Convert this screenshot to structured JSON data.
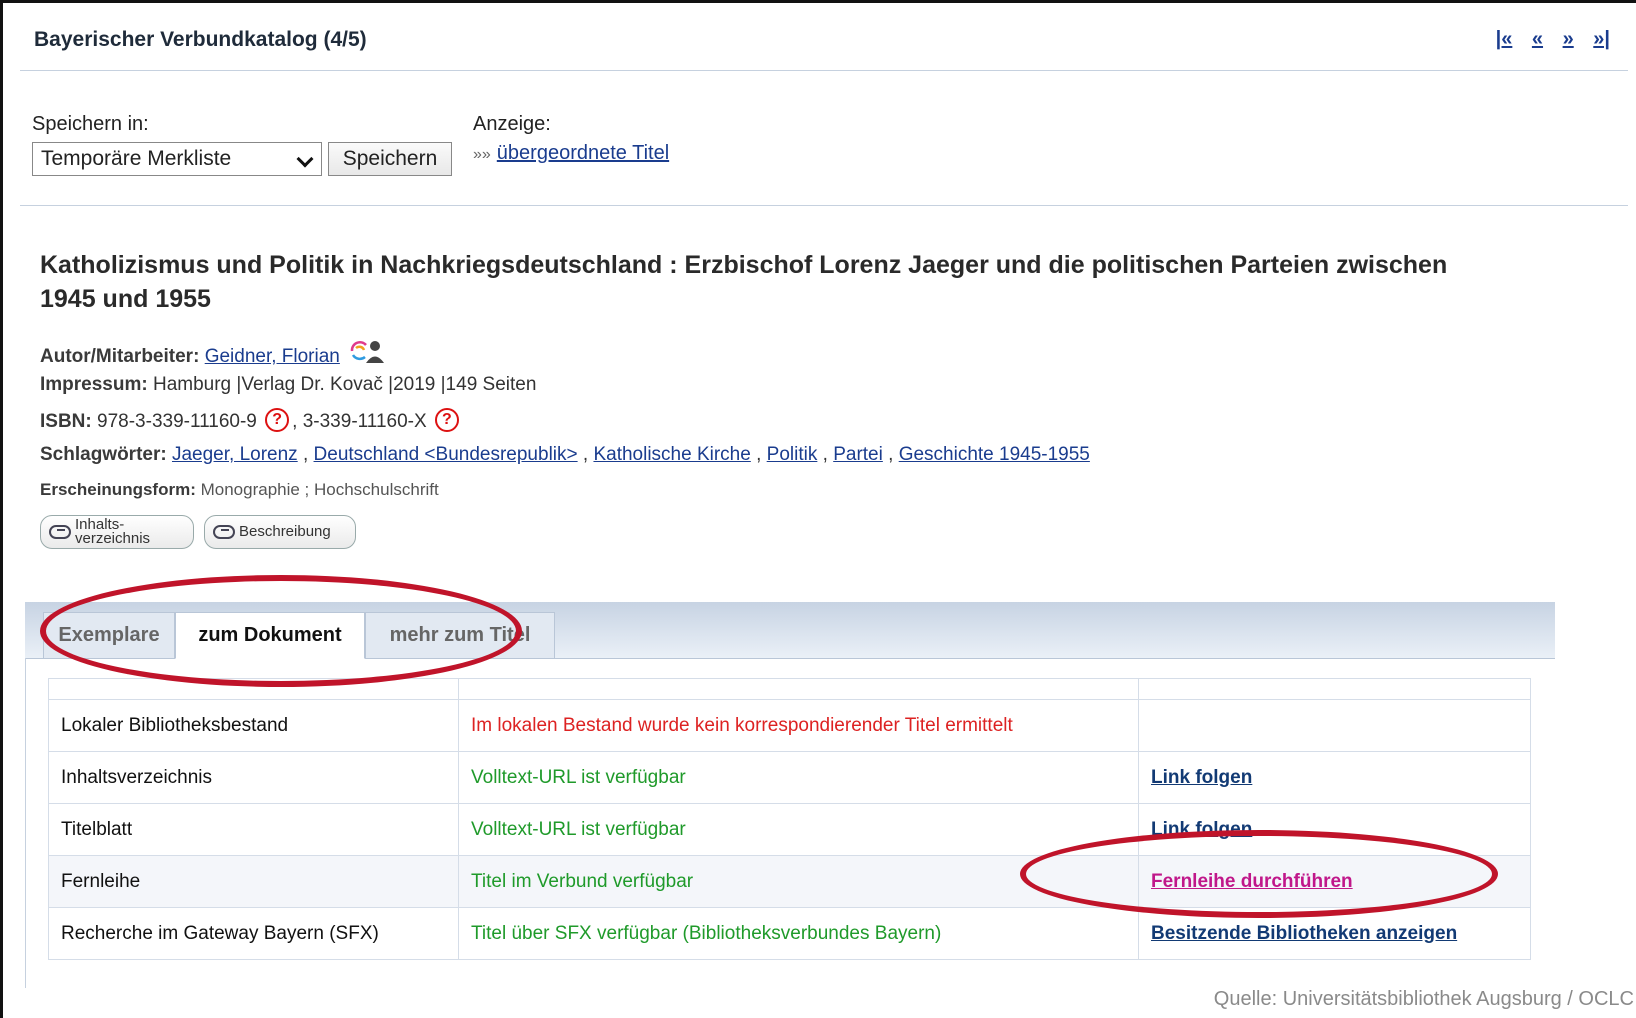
{
  "header": {
    "title": "Bayerischer Verbundkatalog (4/5)",
    "nav": [
      "|«",
      "«",
      "»",
      "»|"
    ]
  },
  "save": {
    "label": "Speichern in:",
    "selected": "Temporäre Merkliste",
    "button": "Speichern"
  },
  "display": {
    "label": "Anzeige:",
    "prefix": "»»",
    "link": "übergeordnete Titel"
  },
  "record": {
    "title": "Katholizismus und Politik in Nachkriegsdeutschland : Erzbischof Lorenz Jaeger und die politischen Parteien zwischen 1945 und 1955",
    "author_label": "Autor/Mitarbeiter:",
    "author": "Geidner, Florian",
    "impressum_label": "Impressum:",
    "impressum": "Hamburg |Verlag Dr. Kovač |2019 |149 Seiten",
    "isbn_label": "ISBN:",
    "isbn1": "978-3-339-11160-9",
    "isbn2": "3-339-11160-X",
    "isbn_sep": ",",
    "subjects_label": "Schlagwörter:",
    "subjects": [
      "Jaeger, Lorenz",
      "Deutschland <Bundesrepublik>",
      "Katholische Kirche",
      "Politik",
      "Partei",
      "Geschichte 1945-1955"
    ],
    "subjects_sep": ",",
    "form_label": "Erscheinungsform:",
    "form": "Monographie ; Hochschulschrift",
    "buttons": {
      "toc_line1": "Inhalts-",
      "toc_line2": "verzeichnis",
      "desc": "Beschreibung"
    }
  },
  "tabs": [
    {
      "label": "Exemplare"
    },
    {
      "label": "zum Dokument"
    },
    {
      "label": "mehr zum Titel"
    }
  ],
  "table": {
    "rows": [
      {
        "label": "Lokaler Bibliotheksbestand",
        "status": "Im lokalen Bestand wurde kein korrespondierender Titel ermittelt",
        "action": ""
      },
      {
        "label": "Inhaltsverzeichnis",
        "status": "Volltext-URL ist verfügbar",
        "action": "Link folgen"
      },
      {
        "label": "Titelblatt",
        "status": "Volltext-URL ist verfügbar",
        "action": "Link folgen"
      },
      {
        "label": "Fernleihe",
        "status": "Titel im Verbund verfügbar",
        "action": "Fernleihe durchführen"
      },
      {
        "label": "Recherche im Gateway Bayern (SFX)",
        "status": "Titel über SFX verfügbar (Bibliotheksverbundes Bayern)",
        "action": "Besitzende Bibliotheken anzeigen"
      }
    ]
  },
  "source": "Quelle: Universitätsbibliothek Augsburg / OCLC",
  "colors": {
    "link": "#1a3c8e",
    "status_red": "#d22222",
    "status_green": "#1f9a2a",
    "highlight_ellipse": "#c0142a",
    "fernleihe_link": "#c0178a"
  }
}
